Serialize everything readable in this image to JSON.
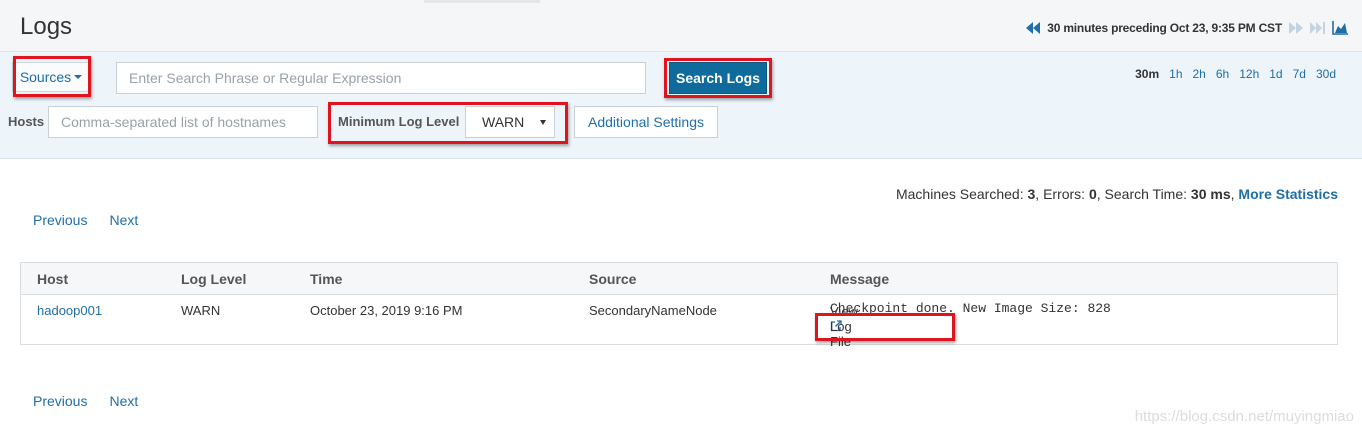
{
  "page": {
    "title": "Logs"
  },
  "time_control": {
    "label": "30 minutes preceding Oct 23, 9:35 PM CST"
  },
  "filters": {
    "sources_label": "Sources",
    "search_placeholder": "Enter Search Phrase or Regular Expression",
    "search_button": "Search Logs",
    "ranges": [
      "30m",
      "1h",
      "2h",
      "6h",
      "12h",
      "1d",
      "7d",
      "30d"
    ],
    "active_range": "30m",
    "hosts_label": "Hosts",
    "hosts_placeholder": "Comma-separated list of hostnames",
    "min_level_label": "Minimum Log Level",
    "min_level_value": "WARN",
    "additional_settings": "Additional Settings"
  },
  "stats": {
    "machines_label": "Machines Searched: ",
    "machines_value": "3",
    "errors_label": ", Errors: ",
    "errors_value": "0",
    "time_label": ", Search Time: ",
    "time_value": "30 ms",
    "sep": ", ",
    "more": "More Statistics"
  },
  "pager": {
    "previous": "Previous",
    "next": "Next"
  },
  "table": {
    "columns": [
      "Host",
      "Log Level",
      "Time",
      "Source",
      "Message"
    ],
    "rows": [
      {
        "host": "hadoop001",
        "level": "WARN",
        "time": "October 23, 2019 9:16 PM",
        "source": "SecondaryNameNode",
        "message": "Checkpoint done. New Image Size: 828",
        "view_log": "View Log File"
      }
    ]
  },
  "watermark": "https://blog.csdn.net/muyingmiao",
  "colors": {
    "link": "#1f6ea8",
    "primary": "#0f6b9c",
    "highlight": "#e0141e"
  }
}
